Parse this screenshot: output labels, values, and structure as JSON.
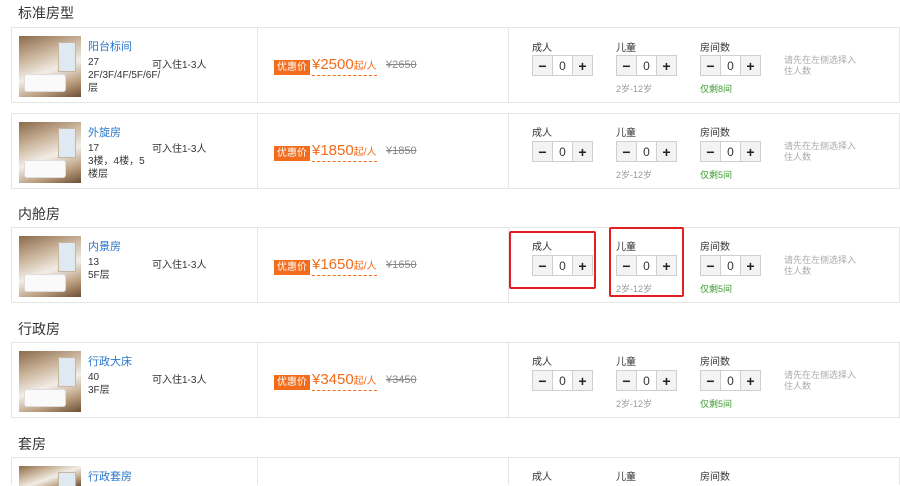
{
  "sections": [
    {
      "title": "标准房型"
    },
    {
      "title": "内舱房"
    },
    {
      "title": "行政房"
    },
    {
      "title": "套房"
    }
  ],
  "labels": {
    "adult": "成人",
    "child": "儿童",
    "rooms": "房间数",
    "minus": "−",
    "plus": "+",
    "note": "请先在左侧选择入住人数",
    "badge": "优惠价",
    "child_age": "2岁-12岁",
    "price_suffix": "起/人"
  },
  "rooms": [
    {
      "name": "阳台标间",
      "area": "27",
      "floors": "2F/3F/4F/5F/6F/层",
      "capacity": "可入住1-3人",
      "price": "¥2500",
      "old_price": "¥2650",
      "adults": "0",
      "children": "0",
      "room_count": "0",
      "remaining": "仅剩8间"
    },
    {
      "name": "外旋房",
      "area": "17",
      "floors": "3楼，4楼，5楼层",
      "capacity": "可入住1-3人",
      "price": "¥1850",
      "old_price": "¥1850",
      "adults": "0",
      "children": "0",
      "room_count": "0",
      "remaining": "仅剩5间"
    },
    {
      "name": "内景房",
      "area": "13",
      "floors": "5F层",
      "capacity": "可入住1-3人",
      "price": "¥1650",
      "old_price": "¥1650",
      "adults": "0",
      "children": "0",
      "room_count": "0",
      "remaining": "仅剩5间"
    },
    {
      "name": "行政大床",
      "area": "40",
      "floors": "3F层",
      "capacity": "可入住1-3人",
      "price": "¥3450",
      "old_price": "¥3450",
      "adults": "0",
      "children": "0",
      "room_count": "0",
      "remaining": "仅剩5间"
    },
    {
      "name": "行政套房",
      "adults": "",
      "children": "",
      "room_count": ""
    }
  ],
  "colors": {
    "accent": "#f26c1b",
    "link": "#2a76c9",
    "stock": "#3a9b2e",
    "highlight": "#e02020"
  }
}
